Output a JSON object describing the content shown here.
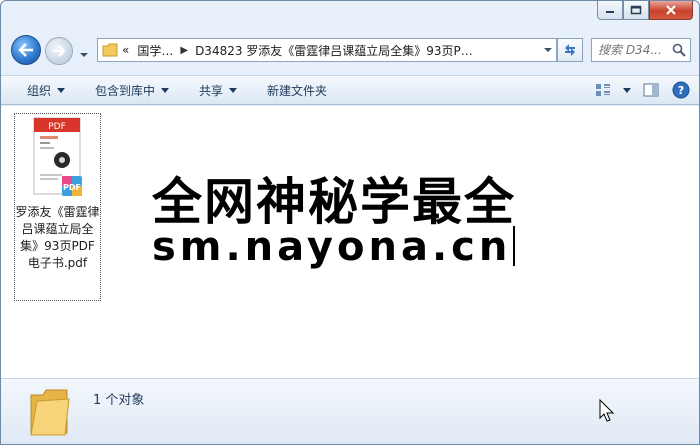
{
  "window": {
    "caption_buttons": [
      "minimize",
      "maximize",
      "close"
    ]
  },
  "address_bar": {
    "overflow_marker": "«",
    "crumbs": [
      "国学…",
      "D34823 罗添友《雷霆律吕课蕴立局全集》93页P…"
    ]
  },
  "search": {
    "placeholder": "搜索 D34..."
  },
  "toolbar": {
    "organize": "组织",
    "include_in_library": "包含到库中",
    "share": "共享",
    "new_folder": "新建文件夹"
  },
  "file": {
    "badge": "PDF",
    "name": "罗添友《雷霆律吕课蕴立局全集》93页PDF电子书.pdf"
  },
  "overlay": {
    "headline": "全网神秘学最全",
    "url": "sm.nayona.cn"
  },
  "status": {
    "item_count": "1 个对象"
  },
  "colors": {
    "accent": "#1e395b",
    "pdf_red": "#d9362b",
    "folder_yellow": "#f3c95c"
  }
}
